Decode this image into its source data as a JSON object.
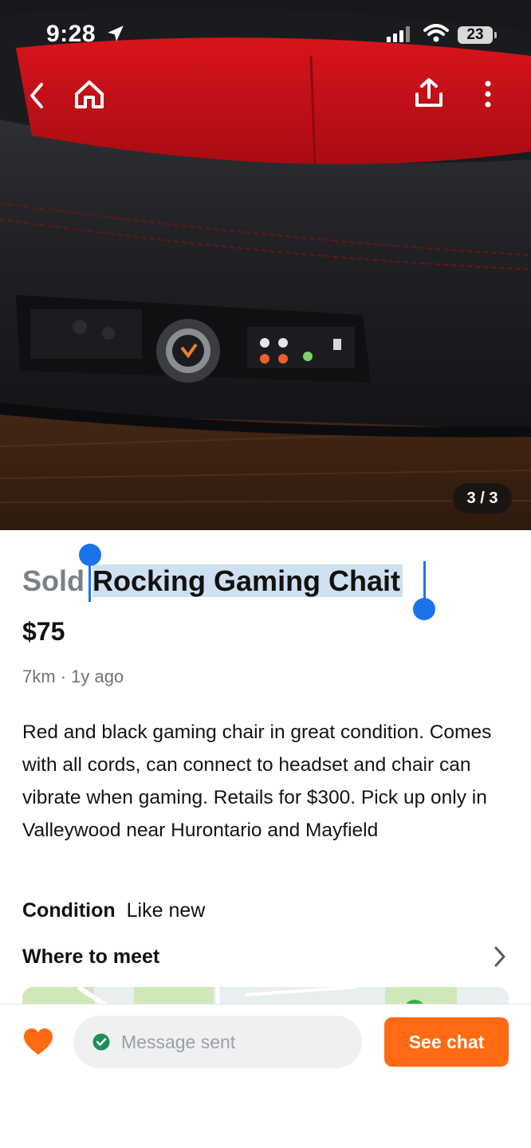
{
  "status_bar": {
    "time": "9:28",
    "battery": "23",
    "icons": [
      "location-arrow-icon",
      "signal-icon",
      "wifi-icon",
      "battery-icon"
    ]
  },
  "photo": {
    "counter": "3 / 3",
    "nav_icons": [
      "back-icon",
      "home-icon",
      "share-icon",
      "more-icon"
    ]
  },
  "listing": {
    "status": "Sold",
    "title": "Rocking Gaming Chait",
    "price": "$75",
    "distance": "7km",
    "separator": "·",
    "age": "1y ago",
    "description": "Red and black gaming chair in great condition. Comes with all cords, can connect to headset and chair can vibrate when gaming. Retails for $300. Pick up only in Valleywood near Hurontario and Mayfield",
    "condition_label": "Condition",
    "condition_value": "Like new",
    "where_label": "Where to meet"
  },
  "bottom_bar": {
    "message_status": "Message sent",
    "chat_button": "See chat"
  },
  "colors": {
    "accent": "#ff6a13",
    "selection": "#1a73e8",
    "selection_highlight": "#cfe0f0",
    "success": "#1e8e5a",
    "muted_text": "#7b7f86"
  }
}
